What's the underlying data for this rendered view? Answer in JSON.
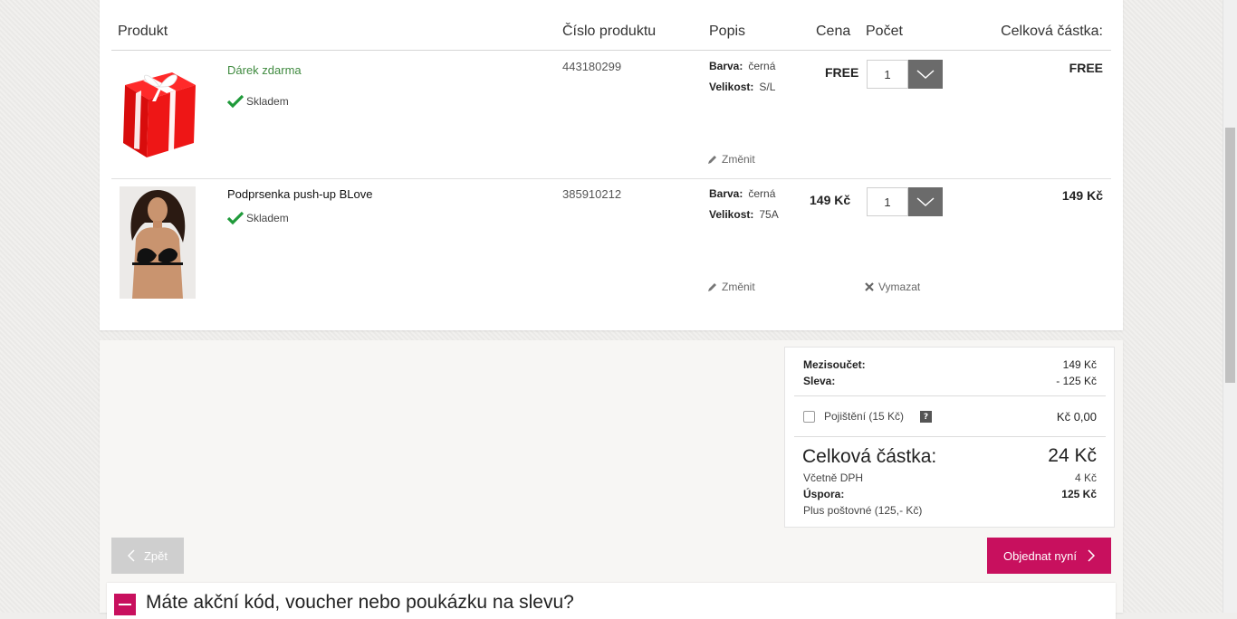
{
  "table": {
    "headers": {
      "product": "Produkt",
      "code": "Číslo produktu",
      "desc": "Popis",
      "price": "Cena",
      "qty": "Počet",
      "total": "Celková částka:"
    }
  },
  "items": [
    {
      "name": "Dárek zdarma",
      "stock": "Skladem",
      "code": "443180299",
      "color_label": "Barva:",
      "color_value": "černá",
      "size_label": "Velikost:",
      "size_value": "S/L",
      "price": "FREE",
      "qty": "1",
      "total": "FREE",
      "change": "Změnit"
    },
    {
      "name": "Podprsenka push-up BLove",
      "stock": "Skladem",
      "code": "385910212",
      "color_label": "Barva:",
      "color_value": "černá",
      "size_label": "Velikost:",
      "size_value": "75A",
      "price": "149 Kč",
      "qty": "1",
      "total": "149 Kč",
      "change": "Změnit",
      "delete": "Vymazat"
    }
  ],
  "summary": {
    "subtotal_label": "Mezisoučet:",
    "subtotal_value": "149 Kč",
    "discount_label": "Sleva:",
    "discount_value": "- 125 Kč",
    "insurance_label": "Pojištění (15 Kč)",
    "insurance_help": "?",
    "insurance_value": "Kč 0,00",
    "total_label": "Celková částka:",
    "total_value": "24 Kč",
    "vat_label": "Včetně DPH",
    "vat_value": "4 Kč",
    "savings_label": "Úspora:",
    "savings_value": "125 Kč",
    "shipping_note": "Plus poštovné (125,- Kč)"
  },
  "buttons": {
    "back": "Zpět",
    "order": "Objednat nyní"
  },
  "voucher": {
    "title": "Máte akční kód, voucher nebo poukázku na slevu?"
  },
  "colors": {
    "accent": "#c8105e",
    "stock_green": "#1f9a3a",
    "free_gift_green": "#3f8a3f"
  }
}
